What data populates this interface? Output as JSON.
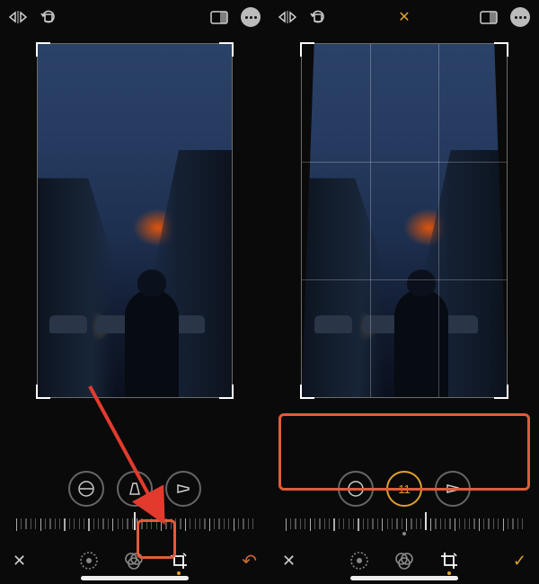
{
  "accent": "#e0a030",
  "left": {
    "perspective_value": "",
    "bottombar": {
      "cancel": "✕",
      "done": "↶"
    }
  },
  "right": {
    "perspective_value": "11",
    "bottombar": {
      "cancel": "✕",
      "done": "✓"
    }
  }
}
